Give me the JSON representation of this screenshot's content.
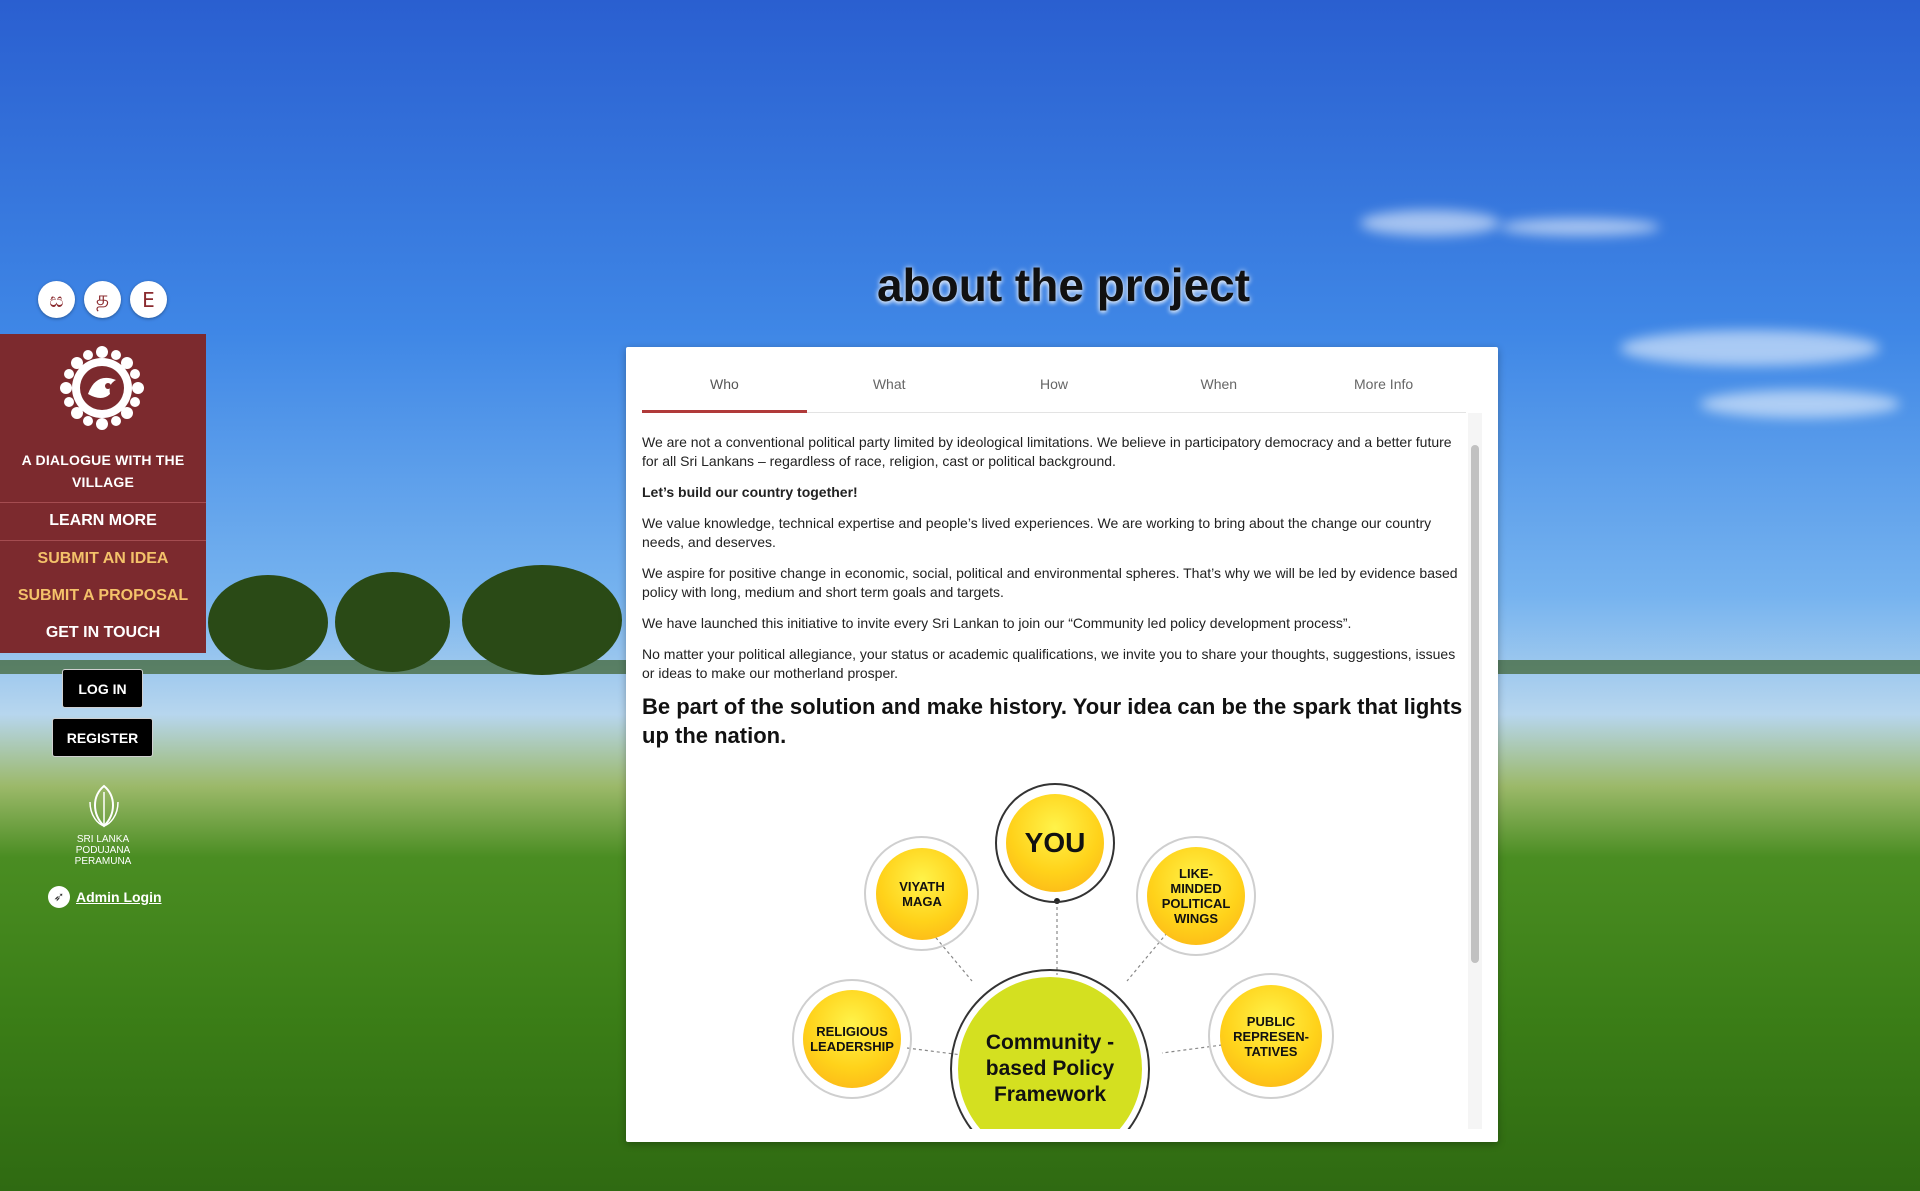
{
  "languages": [
    "ස",
    "த",
    "E"
  ],
  "sidebar": {
    "title": "A DIALOGUE WITH THE VILLAGE",
    "links": [
      "LEARN MORE",
      "SUBMIT AN IDEA",
      "SUBMIT A PROPOSAL",
      "GET IN TOUCH"
    ],
    "login": "LOG IN",
    "register": "REGISTER",
    "slpp_lines": [
      "SRI LANKA",
      "PODUJANA",
      "PERAMUNA"
    ],
    "admin_login": "Admin Login"
  },
  "main": {
    "title": "about the project",
    "tabs": [
      "Who",
      "What",
      "How",
      "When",
      "More Info"
    ],
    "active_tab": "Who",
    "paragraphs": [
      "We are not a conventional political party limited by ideological limitations. We believe in participatory democracy and a better future for all Sri Lankans – regardless of race, religion, cast or political background.",
      "Let’s build our country together!",
      "We value knowledge, technical expertise and people’s lived experiences. We are working to bring about the change our country needs, and deserves.",
      "We aspire for positive change in economic, social, political and environmental spheres. That’s why we will be led by evidence based policy with long, medium and short term goals and targets.",
      "We have launched this initiative to invite every Sri Lankan to join our “Community led policy development process”.",
      "No matter your political allegiance, your status or academic qualifications, we invite you to share your thoughts, suggestions, issues or ideas to make our motherland prosper."
    ],
    "headline": "Be part of the solution and make history. Your idea can be the spark that lights up the nation.",
    "diagram": {
      "center": "Community -based Policy Framework",
      "you": "YOU",
      "nodes": [
        "VIYATH MAGA",
        "LIKE-MINDED POLITICAL WINGS",
        "RELIGIOUS LEADERSHIP",
        "PUBLIC REPRESEN-TATIVES"
      ]
    }
  }
}
